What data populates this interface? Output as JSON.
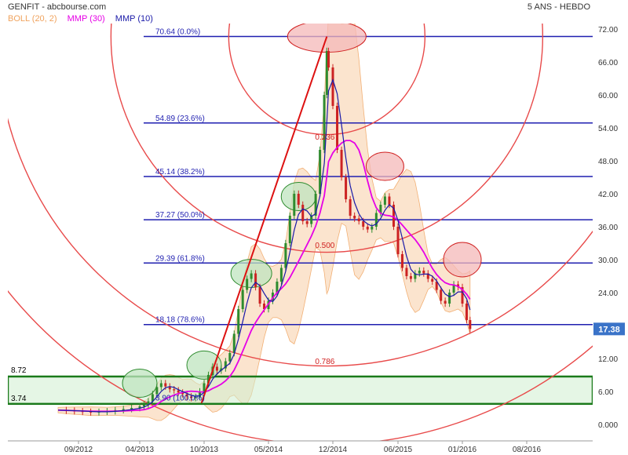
{
  "header": {
    "title": "GENFIT - abcbourse.com",
    "period": "5 ANS - HEBDO"
  },
  "legend": [
    {
      "name": "BOLL (20, 2)",
      "color": "#f0a35e"
    },
    {
      "name": "MMP (30)",
      "color": "#e600e6"
    },
    {
      "name": "MMP (10)",
      "color": "#1a1aa8"
    }
  ],
  "colors": {
    "price_up": "#2e8b2e",
    "price_down": "#cc2222",
    "fib_line": "#1f1fb0",
    "arc": "#e84a4a",
    "boll_fill": "#fbe0c6",
    "support_box": "#1a7a1a",
    "last_price_badge": "#3a73c8"
  },
  "chart_data": {
    "type": "line",
    "title": "",
    "xlabel": "",
    "ylabel": "",
    "ylim": [
      0,
      72
    ],
    "yticks": [
      "72.00",
      "66.00",
      "60.00",
      "54.00",
      "48.00",
      "42.00",
      "36.00",
      "30.00",
      "24.00",
      "18.00",
      "12.00",
      "6.00",
      "0.000"
    ],
    "x_ticks": [
      "09/2012",
      "04/2013",
      "10/2013",
      "05/2014",
      "12/2014",
      "06/2015",
      "01/2016",
      "08/2016"
    ],
    "grid": false,
    "legend_position": "top-left",
    "last_price": "17.38",
    "price_series": [
      [
        2012.0,
        2.6
      ],
      [
        2012.1,
        2.5
      ],
      [
        2012.2,
        2.4
      ],
      [
        2012.3,
        2.3
      ],
      [
        2012.4,
        2.2
      ],
      [
        2012.5,
        2.3
      ],
      [
        2012.6,
        2.4
      ],
      [
        2012.7,
        2.6
      ],
      [
        2012.8,
        2.8
      ],
      [
        2012.9,
        3.0
      ],
      [
        2013.0,
        3.3
      ],
      [
        2013.05,
        3.6
      ],
      [
        2013.1,
        4.2
      ],
      [
        2013.15,
        5.5
      ],
      [
        2013.2,
        6.8
      ],
      [
        2013.25,
        7.5
      ],
      [
        2013.3,
        6.9
      ],
      [
        2013.35,
        6.4
      ],
      [
        2013.4,
        6.2
      ],
      [
        2013.45,
        5.8
      ],
      [
        2013.5,
        5.5
      ],
      [
        2013.55,
        5.1
      ],
      [
        2013.6,
        4.8
      ],
      [
        2013.65,
        5.0
      ],
      [
        2013.7,
        6.0
      ],
      [
        2013.75,
        7.5
      ],
      [
        2013.8,
        9.0
      ],
      [
        2013.85,
        10.5
      ],
      [
        2013.9,
        9.8
      ],
      [
        2013.95,
        10.2
      ],
      [
        2014.0,
        11.5
      ],
      [
        2014.05,
        13.0
      ],
      [
        2014.1,
        16.5
      ],
      [
        2014.15,
        21.0
      ],
      [
        2014.2,
        24.5
      ],
      [
        2014.25,
        26.5
      ],
      [
        2014.3,
        27.5
      ],
      [
        2014.35,
        25.0
      ],
      [
        2014.4,
        22.0
      ],
      [
        2014.45,
        21.0
      ],
      [
        2014.5,
        22.5
      ],
      [
        2014.55,
        24.0
      ],
      [
        2014.6,
        26.0
      ],
      [
        2014.65,
        28.5
      ],
      [
        2014.7,
        33.0
      ],
      [
        2014.75,
        38.0
      ],
      [
        2014.8,
        42.0
      ],
      [
        2014.85,
        40.0
      ],
      [
        2014.9,
        37.0
      ],
      [
        2014.95,
        36.5
      ],
      [
        2015.0,
        38.0
      ],
      [
        2015.05,
        42.0
      ],
      [
        2015.1,
        50.0
      ],
      [
        2015.15,
        60.0
      ],
      [
        2015.18,
        68.0
      ],
      [
        2015.2,
        65.0
      ],
      [
        2015.25,
        58.0
      ],
      [
        2015.3,
        50.0
      ],
      [
        2015.35,
        45.0
      ],
      [
        2015.4,
        41.0
      ],
      [
        2015.45,
        38.0
      ],
      [
        2015.5,
        37.5
      ],
      [
        2015.55,
        37.0
      ],
      [
        2015.6,
        36.0
      ],
      [
        2015.65,
        35.5
      ],
      [
        2015.7,
        36.0
      ],
      [
        2015.75,
        38.5
      ],
      [
        2015.8,
        40.0
      ],
      [
        2015.85,
        41.5
      ],
      [
        2015.9,
        40.0
      ],
      [
        2015.95,
        36.0
      ],
      [
        2016.0,
        31.0
      ],
      [
        2016.05,
        28.5
      ],
      [
        2016.1,
        27.0
      ],
      [
        2016.15,
        26.5
      ],
      [
        2016.2,
        27.5
      ],
      [
        2016.25,
        28.0
      ],
      [
        2016.3,
        27.5
      ],
      [
        2016.35,
        26.5
      ],
      [
        2016.4,
        26.0
      ],
      [
        2016.45,
        24.5
      ],
      [
        2016.5,
        22.5
      ],
      [
        2016.55,
        22.0
      ],
      [
        2016.6,
        24.0
      ],
      [
        2016.65,
        25.5
      ],
      [
        2016.7,
        25.0
      ],
      [
        2016.75,
        22.0
      ],
      [
        2016.8,
        19.0
      ],
      [
        2016.84,
        17.38
      ]
    ],
    "fib_levels": [
      {
        "price": 70.64,
        "label": "70.64  (0.0%)"
      },
      {
        "price": 54.89,
        "label": "54.89  (23.6%)"
      },
      {
        "price": 45.14,
        "label": "45.14  (38.2%)"
      },
      {
        "price": 37.27,
        "label": "37.27  (50.0%)"
      },
      {
        "price": 29.39,
        "label": "29.39  (61.8%)"
      },
      {
        "price": 18.18,
        "label": "18.18  (78.6%)"
      },
      {
        "price": 3.9,
        "label": "3.90  (100.0%)"
      }
    ],
    "fan_arc_labels": [
      "0.236",
      "0.500",
      "0.786"
    ],
    "support_zone": {
      "top": 8.72,
      "bottom": 3.74,
      "top_label": "8.72",
      "bottom_label": "3.74"
    },
    "trend_line": {
      "from": [
        2013.72,
        3.9
      ],
      "to": [
        2015.18,
        70.64
      ]
    }
  }
}
